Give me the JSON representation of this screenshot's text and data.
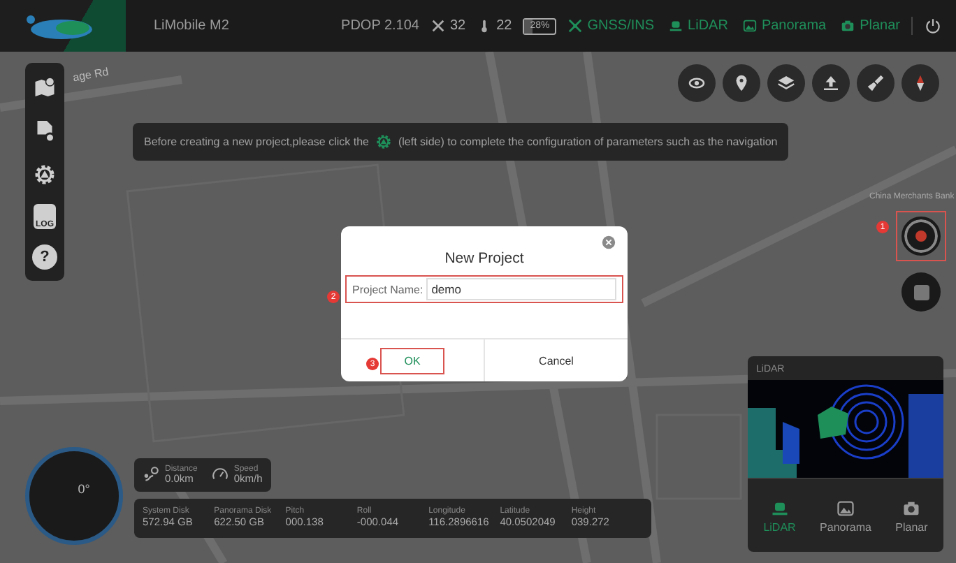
{
  "top_bar": {
    "app_name": "LiMobile M2",
    "pdop": "PDOP 2.104",
    "satellites": "32",
    "temperature": "22",
    "battery": {
      "label": "28%",
      "level": 0.28
    },
    "status_items": [
      {
        "kind": "gnss",
        "label": "GNSS/INS"
      },
      {
        "kind": "lidar",
        "label": "LiDAR"
      },
      {
        "kind": "panorama",
        "label": "Panorama"
      },
      {
        "kind": "planar",
        "label": "Planar"
      }
    ]
  },
  "map_labels": [
    {
      "text": "age Rd"
    },
    {
      "text": "China Merchants Bank"
    }
  ],
  "left_toolbar": [
    {
      "kind": "map"
    },
    {
      "kind": "file-settings"
    },
    {
      "kind": "settings"
    },
    {
      "kind": "log",
      "text": "LOG"
    },
    {
      "kind": "help",
      "text": "?"
    }
  ],
  "map_tools": [
    {
      "kind": "eye"
    },
    {
      "kind": "pin"
    },
    {
      "kind": "layers"
    },
    {
      "kind": "upload"
    },
    {
      "kind": "broom"
    },
    {
      "kind": "compass"
    }
  ],
  "hint": {
    "before": "Before creating a new project,please click the",
    "after": "(left side) to complete the configuration of parameters such as the navigation"
  },
  "step_markers": [
    "1",
    "2",
    "3"
  ],
  "dialog": {
    "title": "New Project",
    "field_label": "Project Name:",
    "field_value": "demo",
    "buttons": [
      {
        "label": "OK",
        "highlighted": true
      },
      {
        "label": "Cancel",
        "highlighted": false
      }
    ]
  },
  "compass": {
    "heading": "0°"
  },
  "motion": [
    {
      "kind": "distance",
      "label": "Distance",
      "value": "0.0km"
    },
    {
      "kind": "speed",
      "label": "Speed",
      "value": "0km/h"
    }
  ],
  "info_bar": [
    {
      "label": "System Disk",
      "value": "572.94 GB"
    },
    {
      "label": "Panorama Disk",
      "value": "622.50 GB"
    },
    {
      "label": "Pitch",
      "value": "000.138"
    },
    {
      "label": "Roll",
      "value": "-000.044"
    },
    {
      "label": "Longitude",
      "value": "116.2896616"
    },
    {
      "label": "Latitude",
      "value": "40.0502049"
    },
    {
      "label": "Height",
      "value": "039.272"
    }
  ],
  "preview": {
    "title": "LiDAR",
    "tabs": [
      {
        "kind": "lidar",
        "label": "LiDAR",
        "selected": true
      },
      {
        "kind": "panorama",
        "label": "Panorama",
        "selected": false
      },
      {
        "kind": "planar",
        "label": "Planar",
        "selected": false
      }
    ]
  }
}
